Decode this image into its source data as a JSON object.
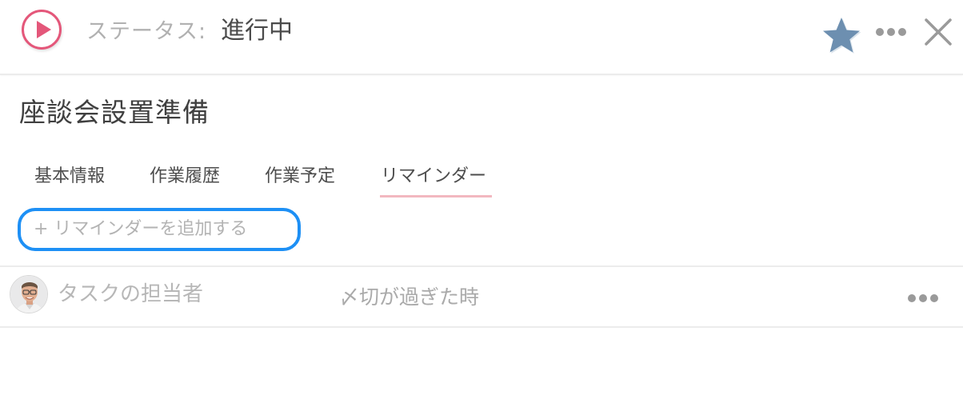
{
  "header": {
    "status_label": "ステータス:",
    "status_value": "進行中",
    "play_icon": "play-icon",
    "star_icon": "star-icon",
    "more_icon": "more-icon",
    "close_icon": "close-icon"
  },
  "task": {
    "title": "座談会設置準備"
  },
  "tabs": [
    {
      "label": "基本情報"
    },
    {
      "label": "作業履歴"
    },
    {
      "label": "作業予定"
    },
    {
      "label": "リマインダー",
      "active": true
    }
  ],
  "reminder": {
    "add_label": "+ リマインダーを追加する",
    "rows": [
      {
        "assignee": "タスクの担当者",
        "timing": "〆切が過ぎた時",
        "more_icon": "more-icon"
      }
    ]
  },
  "colors": {
    "accent_pink": "#e4577a",
    "star_blue": "#6d8fb0",
    "focus_blue": "#1e90f5",
    "tab_underline": "#f2b8c0"
  }
}
